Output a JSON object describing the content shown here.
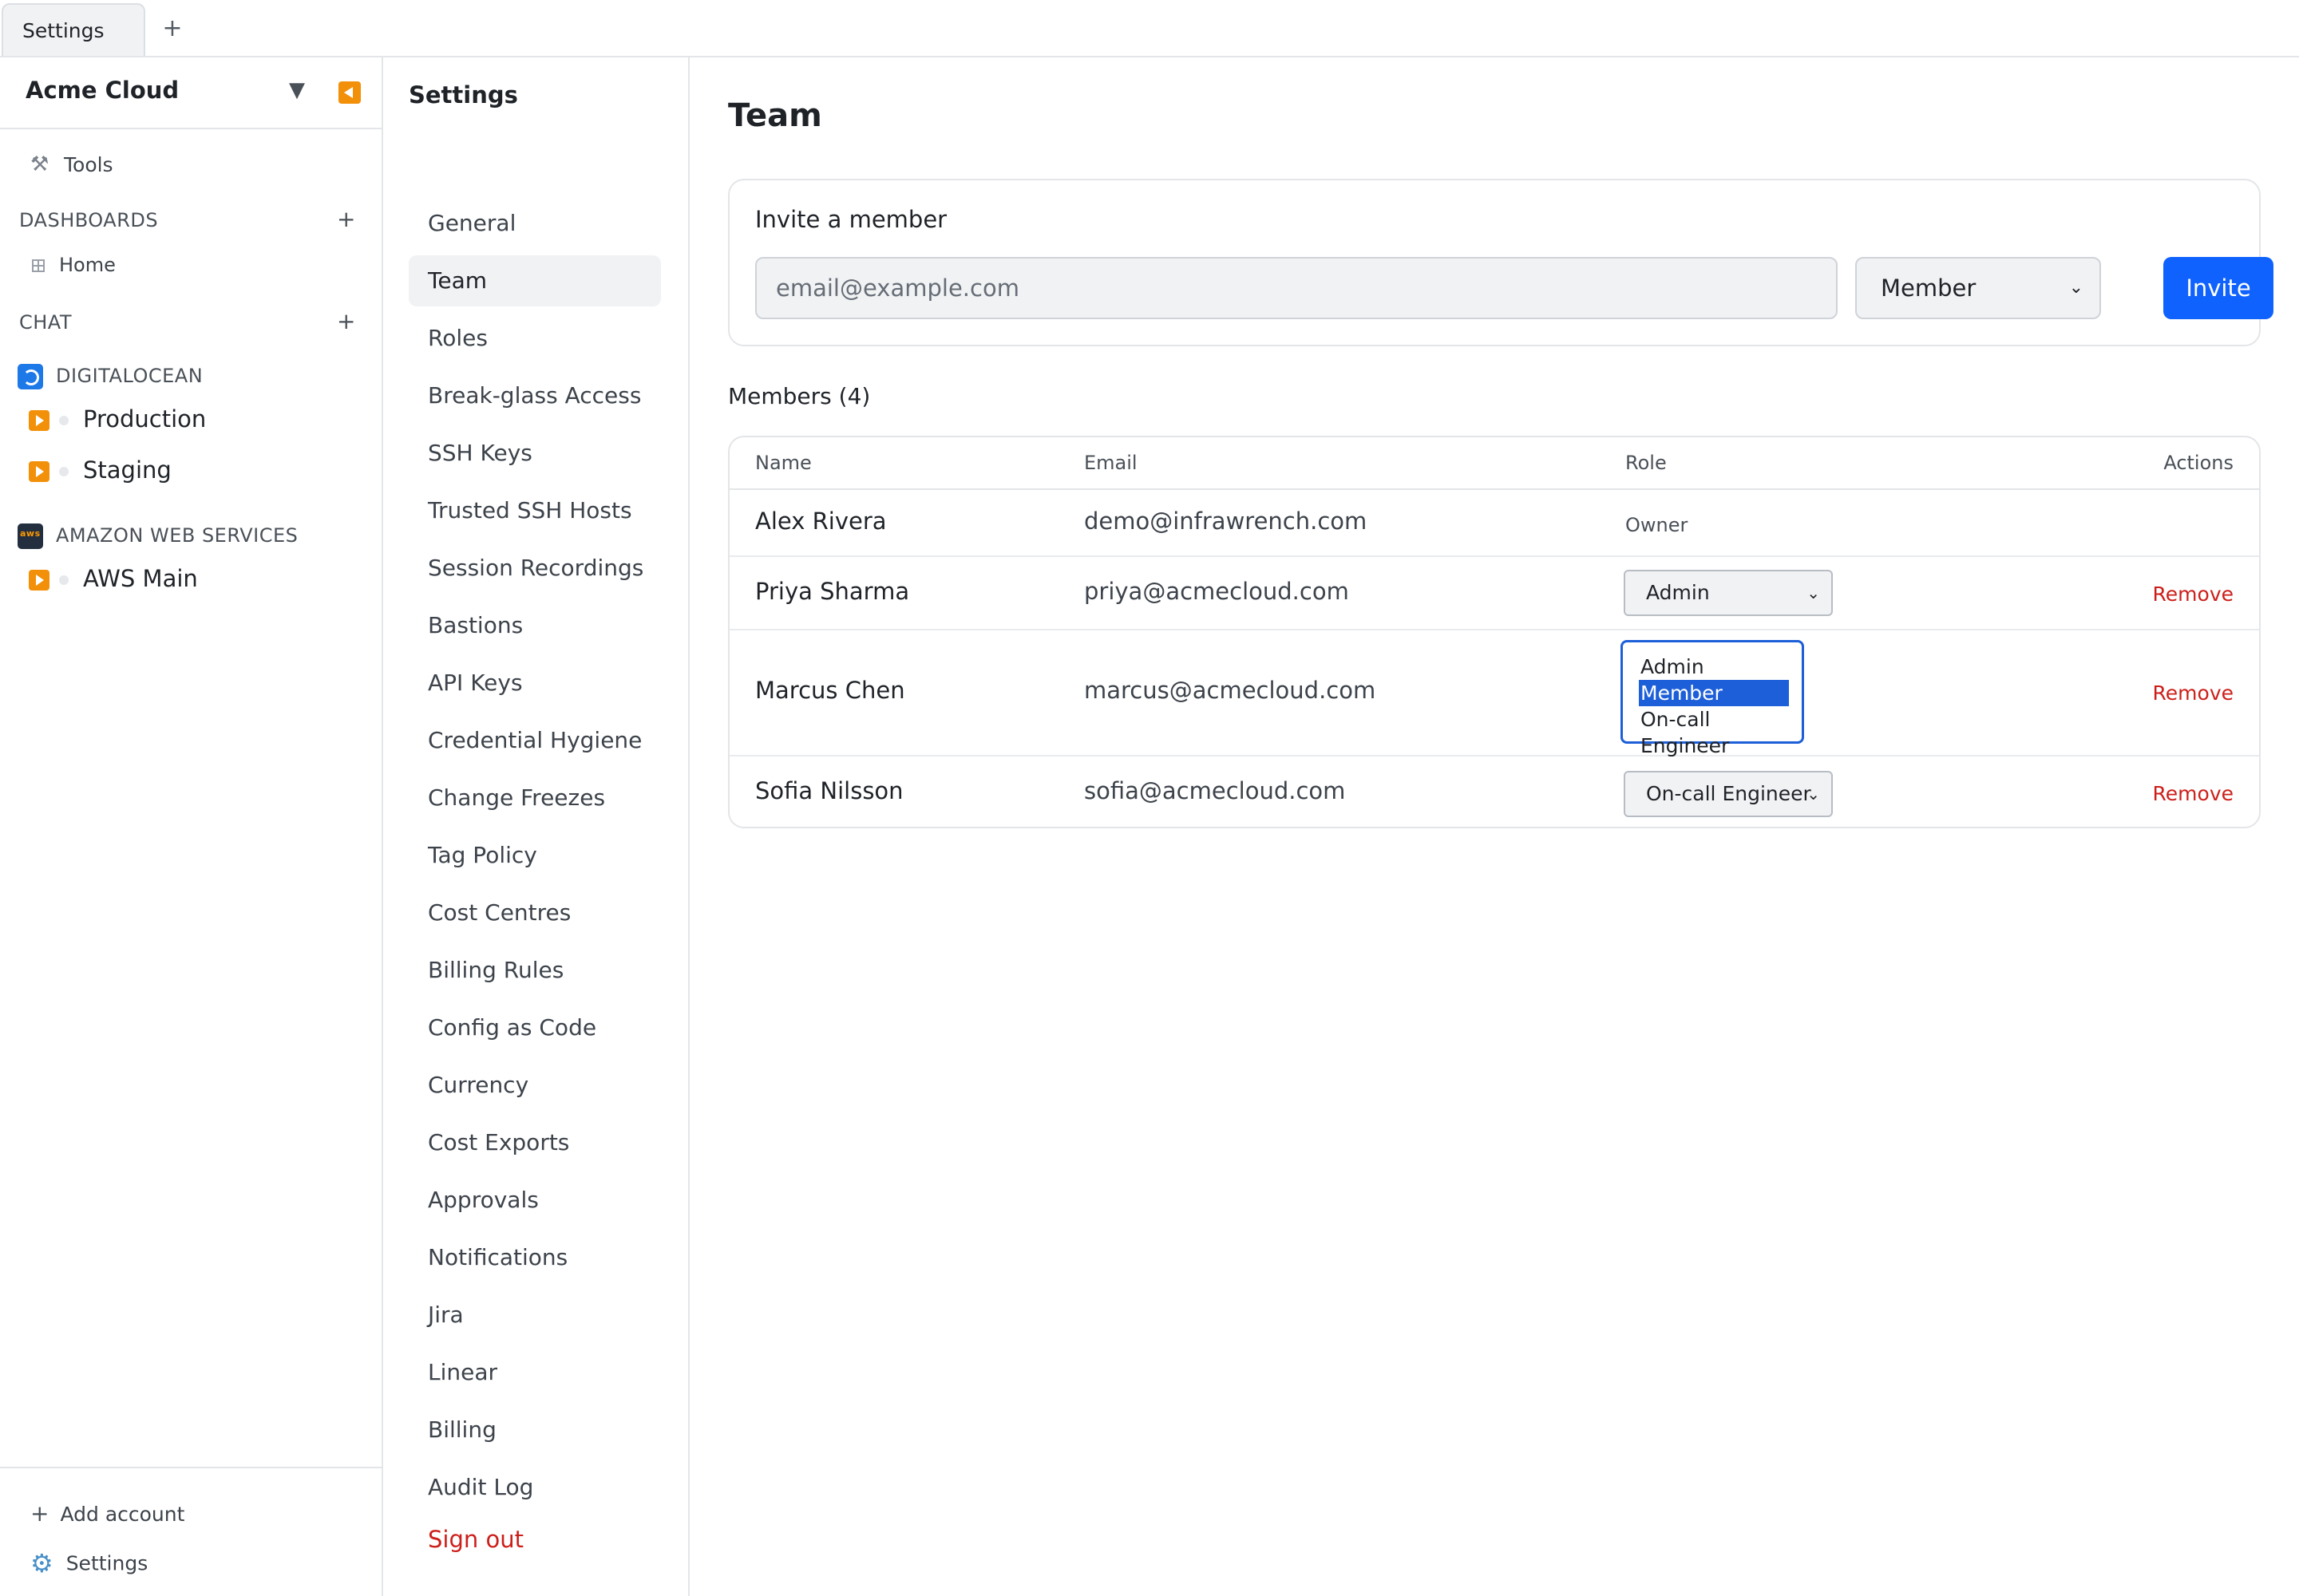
{
  "tabbar": {
    "tab_label": "Settings",
    "add_label": "+"
  },
  "sidebar": {
    "account_name": "Acme Cloud",
    "caret": "▼",
    "tools_label": "Tools",
    "sections": {
      "dashboards": "DASHBOARDS",
      "chat": "CHAT",
      "plus": "+"
    },
    "home_label": "Home",
    "providers": [
      {
        "name": "DIGITALOCEAN",
        "logo": "digitalocean-logo",
        "servers": [
          "Production",
          "Staging"
        ]
      },
      {
        "name": "AMAZON WEB SERVICES",
        "logo": "aws-logo",
        "servers": [
          "AWS Main"
        ]
      }
    ],
    "add_account_label": "Add account",
    "settings_label": "Settings"
  },
  "settings_nav": {
    "title": "Settings",
    "items": [
      "General",
      "Team",
      "Roles",
      "Break-glass Access",
      "SSH Keys",
      "Trusted SSH Hosts",
      "Session Recordings",
      "Bastions",
      "API Keys",
      "Credential Hygiene",
      "Change Freezes",
      "Tag Policy",
      "Cost Centres",
      "Billing Rules",
      "Config as Code",
      "Currency",
      "Cost Exports",
      "Approvals",
      "Notifications",
      "Jira",
      "Linear",
      "Billing",
      "Audit Log"
    ],
    "active": "Team",
    "sign_out": "Sign out"
  },
  "main": {
    "title": "Team",
    "invite": {
      "label": "Invite a member",
      "email_placeholder": "email@example.com",
      "role_value": "Member",
      "button": "Invite"
    },
    "members_title": "Members (4)",
    "table": {
      "headers": {
        "name": "Name",
        "email": "Email",
        "role": "Role",
        "actions": "Actions"
      },
      "rows": [
        {
          "name": "Alex Rivera",
          "email": "demo@infrawrench.com",
          "role": "Owner",
          "action": ""
        },
        {
          "name": "Priya Sharma",
          "email": "priya@acmecloud.com",
          "role": "Admin",
          "action": "Remove"
        },
        {
          "name": "Marcus Chen",
          "email": "marcus@acmecloud.com",
          "role": "Member",
          "action": "Remove",
          "role_options": [
            "Admin",
            "Member",
            "On-call Engineer"
          ]
        },
        {
          "name": "Sofia Nilsson",
          "email": "sofia@acmecloud.com",
          "role": "On-call Engineer",
          "action": "Remove"
        }
      ]
    }
  },
  "colors": {
    "accent": "#0f62fe",
    "danger": "#cc1f1a",
    "brand_orange": "#f2900a"
  }
}
